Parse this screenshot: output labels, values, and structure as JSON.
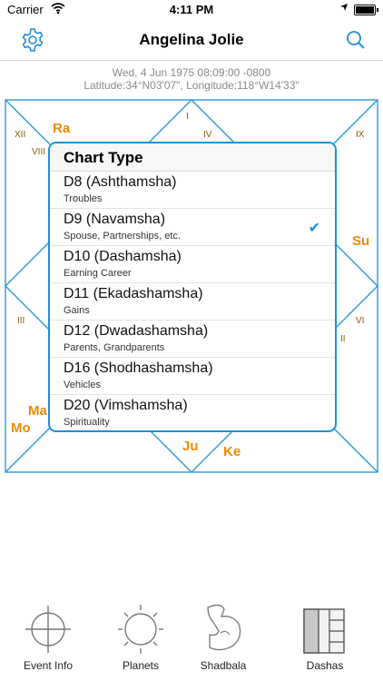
{
  "status_bar": {
    "carrier": "Carrier",
    "time": "4:11 PM"
  },
  "header": {
    "title": "Angelina Jolie",
    "settings_icon": "gear-icon",
    "search_icon": "search-icon"
  },
  "event": {
    "datetime": "Wed, 4 Jun 1975 08:09:00 -0800",
    "location": "Latitude:34°N03'07\", Longitude:118°W14'33\""
  },
  "chart": {
    "house_labels": [
      "I",
      "II",
      "III",
      "IV",
      "VI",
      "VIII",
      "IX",
      "XII"
    ],
    "planets": [
      "Ra",
      "Su",
      "Ma",
      "Mo",
      "Ju",
      "Ke"
    ],
    "colors": {
      "line": "#2a9ad8",
      "planet": "#ee8a00",
      "house": "#8a5a00"
    }
  },
  "chart_type_menu": {
    "title": "Chart Type",
    "items": [
      {
        "title": "D8 (Ashthamsha)",
        "subtitle": "Troubles",
        "selected": false
      },
      {
        "title": "D9 (Navamsha)",
        "subtitle": "Spouse, Partnerships, etc.",
        "selected": true,
        "check": "✔"
      },
      {
        "title": "D10 (Dashamsha)",
        "subtitle": "Earning Career",
        "selected": false
      },
      {
        "title": "D11 (Ekadashamsha)",
        "subtitle": "Gains",
        "selected": false
      },
      {
        "title": "D12 (Dwadashamsha)",
        "subtitle": "Parents, Grandparents",
        "selected": false
      },
      {
        "title": "D16 (Shodhashamsha)",
        "subtitle": "Vehicles",
        "selected": false
      },
      {
        "title": "D20 (Vimshamsha)",
        "subtitle": "Spirituality",
        "selected": false
      }
    ]
  },
  "tab_bar": {
    "tabs": [
      {
        "label": "Event Info",
        "icon": "crosshair-icon"
      },
      {
        "label": "Planets",
        "icon": "sun-icon"
      },
      {
        "label": "Shadbala",
        "icon": "flexed-arm-icon"
      },
      {
        "label": "Dashas",
        "icon": "dasha-grid-icon"
      }
    ]
  }
}
